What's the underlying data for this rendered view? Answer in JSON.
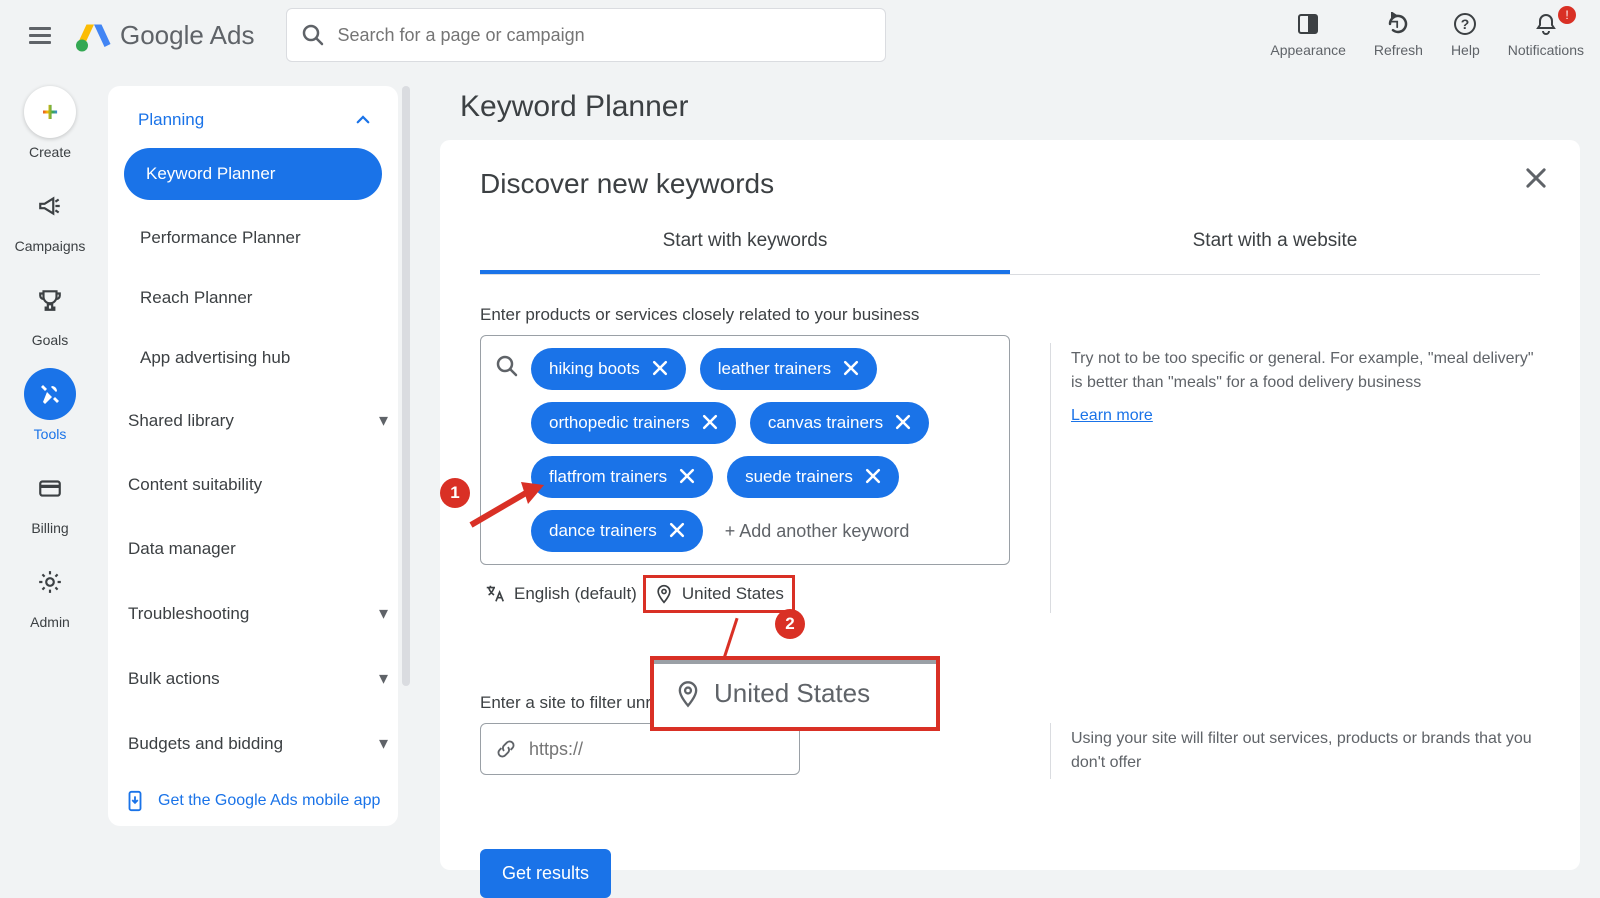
{
  "brand": {
    "name_bold": "Google",
    "name_light": "Ads"
  },
  "search": {
    "placeholder": "Search for a page or campaign"
  },
  "header_tools": {
    "appearance": "Appearance",
    "refresh": "Refresh",
    "help": "Help",
    "notifications": "Notifications",
    "alert": "!"
  },
  "rail": {
    "create": "Create",
    "campaigns": "Campaigns",
    "goals": "Goals",
    "tools": "Tools",
    "billing": "Billing",
    "admin": "Admin"
  },
  "sidepanel": {
    "planning": "Planning",
    "items": [
      {
        "label": "Keyword Planner"
      },
      {
        "label": "Performance Planner"
      },
      {
        "label": "Reach Planner"
      },
      {
        "label": "App advertising hub"
      }
    ],
    "rows": [
      "Shared library",
      "Content suitability",
      "Data manager",
      "Troubleshooting",
      "Bulk actions",
      "Budgets and bidding"
    ],
    "mobile_app": "Get the Google Ads mobile app"
  },
  "page": {
    "title": "Keyword Planner",
    "card_title": "Discover new keywords",
    "tabs": {
      "keywords": "Start with keywords",
      "website": "Start with a website"
    },
    "instruction": "Enter products or services closely related to your business",
    "chips": [
      "hiking boots",
      "leather trainers",
      "orthopedic trainers",
      "canvas trainers",
      "flatfrom trainers",
      "suede trainers",
      "dance trainers"
    ],
    "add_keyword": "+ Add another keyword",
    "language": "English (default)",
    "location": "United States",
    "tip": "Try not to be too specific or general. For example, \"meal delivery\" is better than \"meals\" for a food delivery business",
    "learn_more": "Learn more",
    "site_instruction": "Enter a site to filter unrel",
    "site_placeholder": "https://",
    "site_tip": "Using your site will filter out services, products or brands that you don't offer",
    "get_results": "Get results",
    "badges": {
      "one": "1",
      "two": "2"
    },
    "popout": "United States"
  }
}
